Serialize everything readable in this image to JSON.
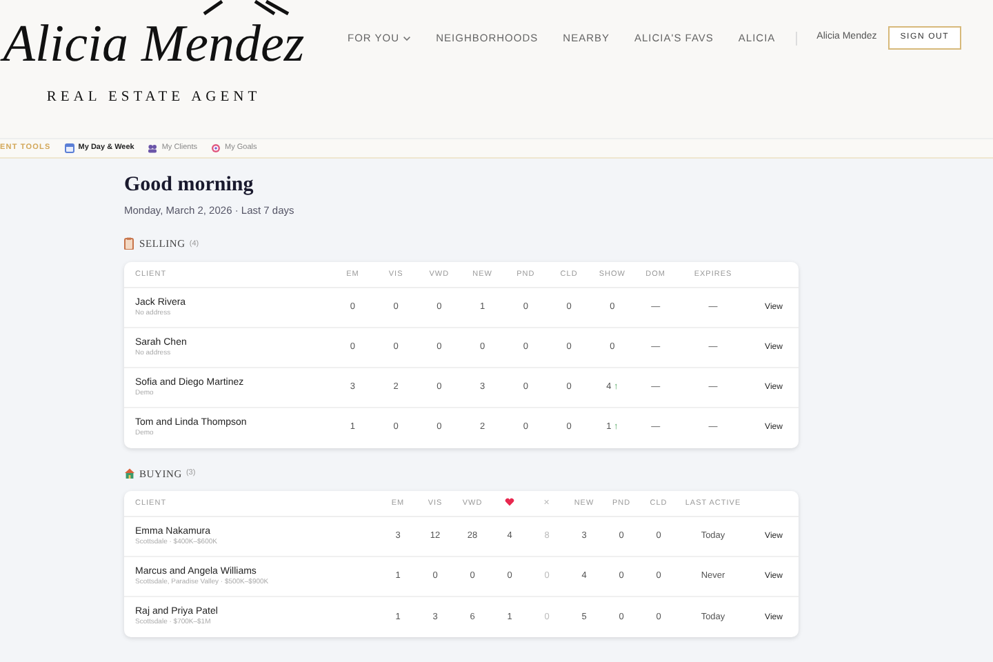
{
  "brand": {
    "name": "Alicia Mendez",
    "tagline": "REAL ESTATE AGENT"
  },
  "nav": {
    "items": [
      {
        "label": "FOR YOU",
        "dropdown": true
      },
      {
        "label": "NEIGHBORHOODS",
        "dropdown": false
      },
      {
        "label": "NEARBY",
        "dropdown": false
      },
      {
        "label": "ALICIA'S FAVS",
        "dropdown": false
      },
      {
        "label": "ALICIA",
        "dropdown": false
      }
    ],
    "user": "Alicia Mendez",
    "sign_out": "SIGN OUT"
  },
  "tools": {
    "label": "ENT TOOLS",
    "tabs": [
      {
        "label": "My Day & Week",
        "selected": true
      },
      {
        "label": "My Clients",
        "selected": false
      },
      {
        "label": "My Goals",
        "selected": false
      }
    ]
  },
  "greeting": "Good morning",
  "subtitle": "Monday, March 2, 2026 · Last 7 days",
  "sections": [
    {
      "title": "SELLING",
      "count": "(4)",
      "client_header": "CLIENT",
      "columns": [
        {
          "kind": "text",
          "label": "EM"
        },
        {
          "kind": "text",
          "label": "VIS"
        },
        {
          "kind": "text",
          "label": "VWD"
        },
        {
          "kind": "text",
          "label": "NEW"
        },
        {
          "kind": "text",
          "label": "PND"
        },
        {
          "kind": "text",
          "label": "CLD"
        },
        {
          "kind": "text",
          "label": "SHOW"
        },
        {
          "kind": "text",
          "label": "DOM"
        },
        {
          "kind": "text",
          "label": "EXPIRES"
        }
      ],
      "rows": [
        {
          "name": "Jack Rivera",
          "detail": "No address",
          "cells": [
            {
              "value": "0"
            },
            {
              "value": "0"
            },
            {
              "value": "0"
            },
            {
              "value": "1"
            },
            {
              "value": "0"
            },
            {
              "value": "0"
            },
            {
              "value": "0"
            },
            {
              "value": "—"
            },
            {
              "value": "—"
            }
          ],
          "action": "View"
        },
        {
          "name": "Sarah Chen",
          "detail": "No address",
          "cells": [
            {
              "value": "0"
            },
            {
              "value": "0"
            },
            {
              "value": "0"
            },
            {
              "value": "0"
            },
            {
              "value": "0"
            },
            {
              "value": "0"
            },
            {
              "value": "0"
            },
            {
              "value": "—"
            },
            {
              "value": "—"
            }
          ],
          "action": "View"
        },
        {
          "name": "Sofia and Diego Martinez",
          "detail": "Demo",
          "cells": [
            {
              "value": "3"
            },
            {
              "value": "2"
            },
            {
              "value": "0"
            },
            {
              "value": "3"
            },
            {
              "value": "0"
            },
            {
              "value": "0"
            },
            {
              "value": "4",
              "trend": "↑"
            },
            {
              "value": "—"
            },
            {
              "value": "—"
            }
          ],
          "action": "View"
        },
        {
          "name": "Tom and Linda Thompson",
          "detail": "Demo",
          "cells": [
            {
              "value": "1"
            },
            {
              "value": "0"
            },
            {
              "value": "0"
            },
            {
              "value": "2"
            },
            {
              "value": "0"
            },
            {
              "value": "0"
            },
            {
              "value": "1",
              "trend": "↑"
            },
            {
              "value": "—"
            },
            {
              "value": "—"
            }
          ],
          "action": "View"
        }
      ]
    },
    {
      "title": "BUYING",
      "count": "(3)",
      "client_header": "CLIENT",
      "columns": [
        {
          "kind": "text",
          "label": "EM"
        },
        {
          "kind": "text",
          "label": "VIS"
        },
        {
          "kind": "text",
          "label": "VWD"
        },
        {
          "kind": "heart"
        },
        {
          "kind": "text",
          "label": "✕",
          "muted": true
        },
        {
          "kind": "text",
          "label": "NEW"
        },
        {
          "kind": "text",
          "label": "PND"
        },
        {
          "kind": "text",
          "label": "CLD"
        },
        {
          "kind": "text",
          "label": "LAST ACTIVE"
        }
      ],
      "rows": [
        {
          "name": "Emma Nakamura",
          "detail": "Scottsdale · $400K–$600K",
          "cells": [
            {
              "value": "3"
            },
            {
              "value": "12"
            },
            {
              "value": "28"
            },
            {
              "value": "4"
            },
            {
              "value": "8"
            },
            {
              "value": "3"
            },
            {
              "value": "0"
            },
            {
              "value": "0"
            },
            {
              "value": "Today"
            }
          ],
          "action": "View"
        },
        {
          "name": "Marcus and Angela Williams",
          "detail": "Scottsdale, Paradise Valley · $500K–$900K",
          "cells": [
            {
              "value": "1"
            },
            {
              "value": "0"
            },
            {
              "value": "0"
            },
            {
              "value": "0"
            },
            {
              "value": "0"
            },
            {
              "value": "4"
            },
            {
              "value": "0"
            },
            {
              "value": "0"
            },
            {
              "value": "Never"
            }
          ],
          "action": "View"
        },
        {
          "name": "Raj and Priya Patel",
          "detail": "Scottsdale · $700K–$1M",
          "cells": [
            {
              "value": "1"
            },
            {
              "value": "3"
            },
            {
              "value": "6"
            },
            {
              "value": "1"
            },
            {
              "value": "0"
            },
            {
              "value": "5"
            },
            {
              "value": "0"
            },
            {
              "value": "0"
            },
            {
              "value": "Today"
            }
          ],
          "action": "View"
        }
      ]
    }
  ]
}
